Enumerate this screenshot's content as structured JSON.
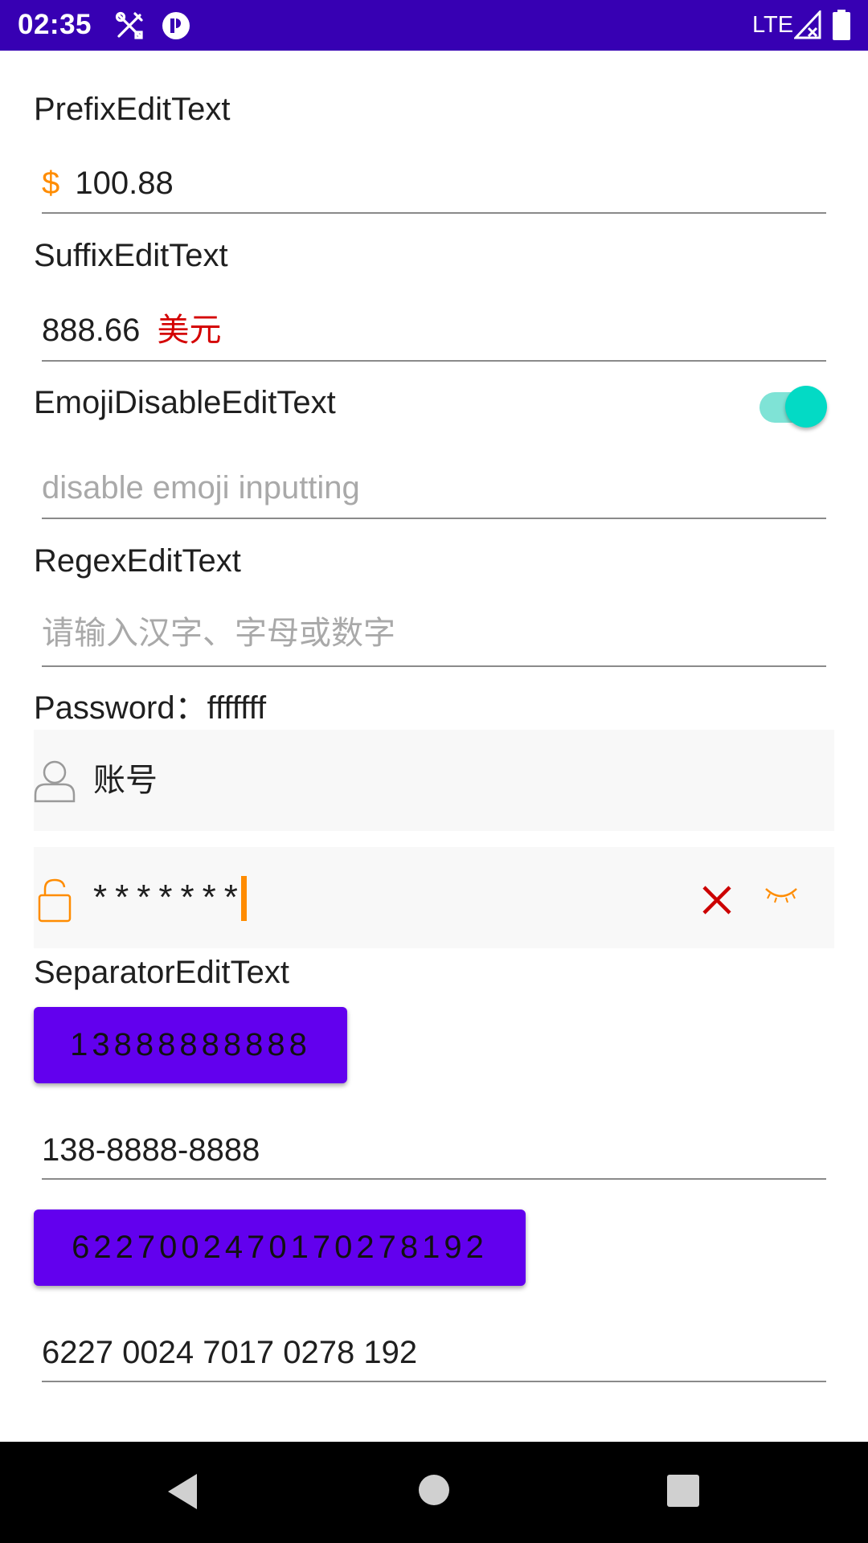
{
  "status_bar": {
    "time": "02:35",
    "network": "LTE",
    "icons": [
      "tools-icon",
      "notification-icon",
      "signal-icon",
      "battery-icon"
    ]
  },
  "prefix_section": {
    "label": "PrefixEditText",
    "prefix": "$",
    "value": "100.88"
  },
  "suffix_section": {
    "label": "SuffixEditText",
    "value": "888.66",
    "suffix": "美元"
  },
  "emoji_section": {
    "label": "EmojiDisableEditText",
    "toggle_on": true,
    "placeholder": "disable emoji inputting"
  },
  "regex_section": {
    "label": "RegexEditText",
    "placeholder": "请输入汉字、字母或数字"
  },
  "password_section": {
    "label": "Password：fffffff",
    "account_value": "账号",
    "password_masked": "*******"
  },
  "separator_section": {
    "label": "SeparatorEditText",
    "phone_button": "13888888888",
    "phone_formatted": "138-8888-8888",
    "card_button": "6227002470170278192",
    "card_formatted": "6227 0024 7017 0278 192"
  },
  "colors": {
    "status_bar": "#3700b3",
    "accent": "#ff8c00",
    "suffix": "#d40000",
    "toggle": "#03dac5",
    "button": "#6200ee",
    "clear_icon": "#cc0000"
  },
  "nav_bar": {
    "icons": [
      "back-icon",
      "home-icon",
      "recents-icon"
    ]
  }
}
